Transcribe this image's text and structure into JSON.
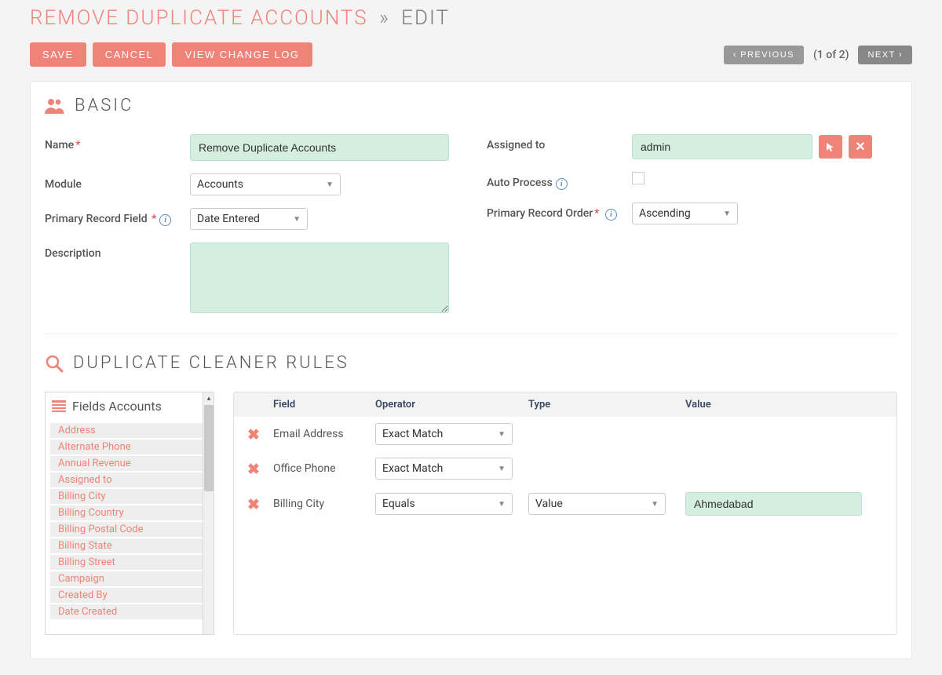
{
  "header": {
    "title_main": "REMOVE DUPLICATE ACCOUNTS",
    "title_sub": "EDIT"
  },
  "toolbar": {
    "save": "SAVE",
    "cancel": "CANCEL",
    "view_change_log": "VIEW CHANGE LOG",
    "previous": "PREVIOUS",
    "next": "NEXT",
    "pager": "(1 of 2)"
  },
  "sections": {
    "basic": "BASIC",
    "rules": "DUPLICATE CLEANER RULES"
  },
  "form": {
    "name": {
      "label": "Name",
      "value": "Remove Duplicate Accounts"
    },
    "module": {
      "label": "Module",
      "value": "Accounts"
    },
    "primary_record_field": {
      "label": "Primary Record Field",
      "value": "Date Entered"
    },
    "description": {
      "label": "Description",
      "value": ""
    },
    "assigned_to": {
      "label": "Assigned to",
      "value": "admin"
    },
    "auto_process": {
      "label": "Auto Process",
      "checked": false
    },
    "primary_record_order": {
      "label": "Primary Record Order",
      "value": "Ascending"
    }
  },
  "fields_panel": {
    "title": "Fields Accounts",
    "items": [
      "Address",
      "Alternate Phone",
      "Annual Revenue",
      "Assigned to",
      "Billing City",
      "Billing Country",
      "Billing Postal Code",
      "Billing State",
      "Billing Street",
      "Campaign",
      "Created By",
      "Date Created"
    ]
  },
  "rules": {
    "columns": {
      "field": "Field",
      "operator": "Operator",
      "type": "Type",
      "value": "Value"
    },
    "rows": [
      {
        "field": "Email Address",
        "operator": "Exact Match",
        "type": "",
        "value": ""
      },
      {
        "field": "Office Phone",
        "operator": "Exact Match",
        "type": "",
        "value": ""
      },
      {
        "field": "Billing City",
        "operator": "Equals",
        "type": "Value",
        "value": "Ahmedabad"
      }
    ]
  }
}
